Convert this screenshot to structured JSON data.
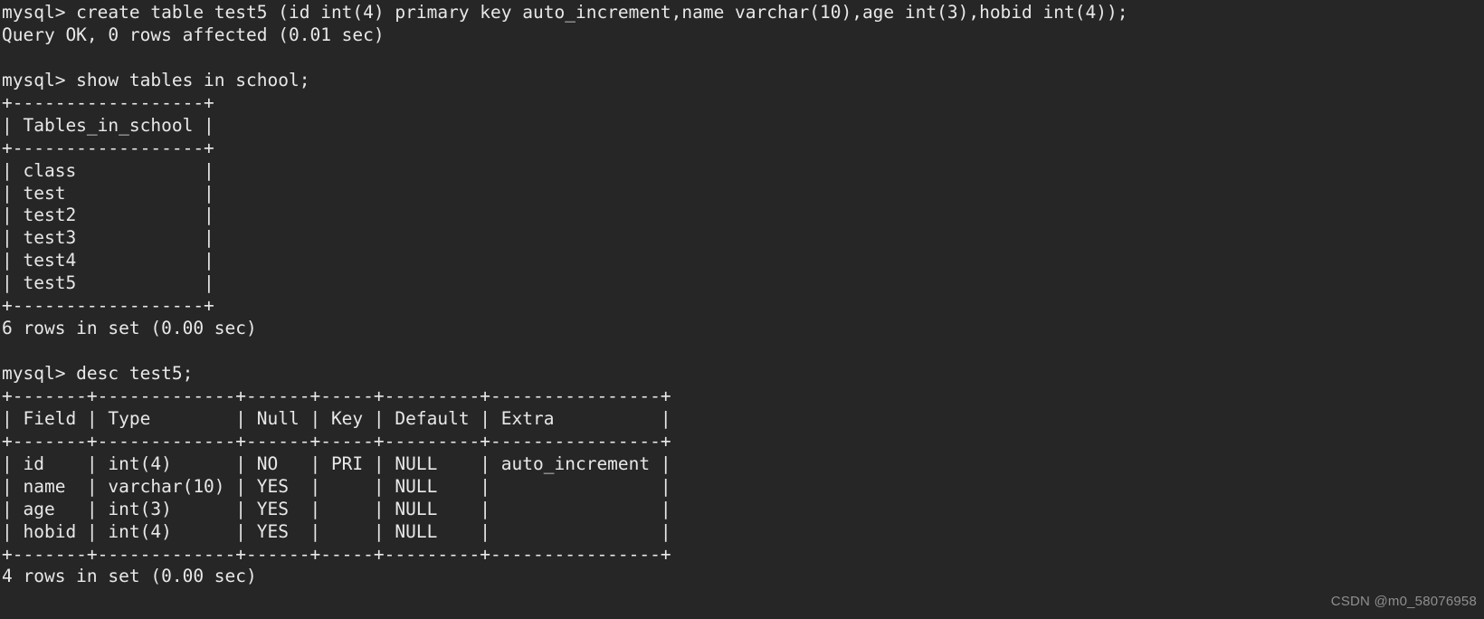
{
  "terminal": {
    "background_color": "#262626",
    "text_color": "#e8e8e8",
    "prompt": "mysql>",
    "lines": [
      "mysql> create table test5 (id int(4) primary key auto_increment,name varchar(10),age int(3),hobid int(4));",
      "Query OK, 0 rows affected (0.01 sec)",
      "",
      "mysql> show tables in school;",
      "+------------------+",
      "| Tables_in_school |",
      "+------------------+",
      "| class            |",
      "| test             |",
      "| test2            |",
      "| test3            |",
      "| test4            |",
      "| test5            |",
      "+------------------+",
      "6 rows in set (0.00 sec)",
      "",
      "mysql> desc test5;",
      "+-------+-------------+------+-----+---------+----------------+",
      "| Field | Type        | Null | Key | Default | Extra          |",
      "+-------+-------------+------+-----+---------+----------------+",
      "| id    | int(4)      | NO   | PRI | NULL    | auto_increment |",
      "| name  | varchar(10) | YES  |     | NULL    |                |",
      "| age   | int(3)      | YES  |     | NULL    |                |",
      "| hobid | int(4)      | YES  |     | NULL    |                |",
      "+-------+-------------+------+-----+---------+----------------+",
      "4 rows in set (0.00 sec)"
    ],
    "commands": [
      {
        "prompt": "mysql>",
        "text": "create table test5 (id int(4) primary key auto_increment,name varchar(10),age int(3),hobid int(4));",
        "result": "Query OK, 0 rows affected (0.01 sec)"
      },
      {
        "prompt": "mysql>",
        "text": "show tables in school;",
        "result": "6 rows in set (0.00 sec)"
      },
      {
        "prompt": "mysql>",
        "text": "desc test5;",
        "result": "4 rows in set (0.00 sec)"
      }
    ],
    "tables": [
      {
        "name": "show-tables-result",
        "columns": [
          "Tables_in_school"
        ],
        "rows": [
          [
            "class"
          ],
          [
            "test"
          ],
          [
            "test2"
          ],
          [
            "test3"
          ],
          [
            "test4"
          ],
          [
            "test5"
          ]
        ],
        "status": "6 rows in set (0.00 sec)"
      },
      {
        "name": "desc-test5-result",
        "columns": [
          "Field",
          "Type",
          "Null",
          "Key",
          "Default",
          "Extra"
        ],
        "rows": [
          [
            "id",
            "int(4)",
            "NO",
            "PRI",
            "NULL",
            "auto_increment"
          ],
          [
            "name",
            "varchar(10)",
            "YES",
            "",
            "NULL",
            ""
          ],
          [
            "age",
            "int(3)",
            "YES",
            "",
            "NULL",
            ""
          ],
          [
            "hobid",
            "int(4)",
            "YES",
            "",
            "NULL",
            ""
          ]
        ],
        "status": "4 rows in set (0.00 sec)"
      }
    ]
  },
  "watermark": {
    "text": "CSDN @m0_58076958",
    "color": "#8f8f8f"
  }
}
